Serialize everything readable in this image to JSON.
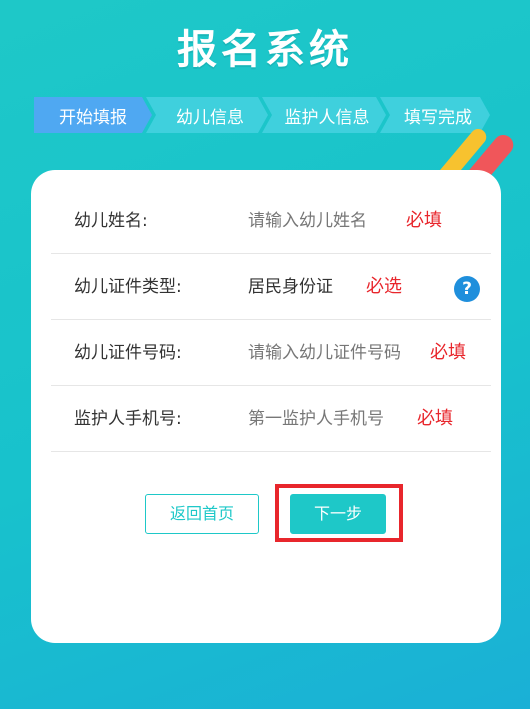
{
  "header": {
    "title": "报名系统"
  },
  "steps": [
    {
      "label": "开始填报",
      "active": true
    },
    {
      "label": "幼儿信息",
      "active": false
    },
    {
      "label": "监护人信息",
      "active": false
    },
    {
      "label": "填写完成",
      "active": false
    }
  ],
  "form": {
    "rows": [
      {
        "label": "幼儿姓名:",
        "placeholder": "请输入幼儿姓名",
        "required": "必填"
      },
      {
        "label": "幼儿证件类型:",
        "value": "居民身份证",
        "required": "必选"
      },
      {
        "label": "幼儿证件号码:",
        "placeholder": "请输入幼儿证件号码",
        "required": "必填"
      },
      {
        "label": "监护人手机号:",
        "placeholder": "第一监护人手机号",
        "required": "必填"
      }
    ],
    "help_icon_text": "?"
  },
  "buttons": {
    "back_label": "返回首页",
    "next_label": "下一步"
  },
  "colors": {
    "accent": "#1ec8c8",
    "required": "#e8262c",
    "active_step": "#4fa8f2",
    "help": "#1f8fdc"
  },
  "icons": {
    "help": "question-circle-icon"
  }
}
